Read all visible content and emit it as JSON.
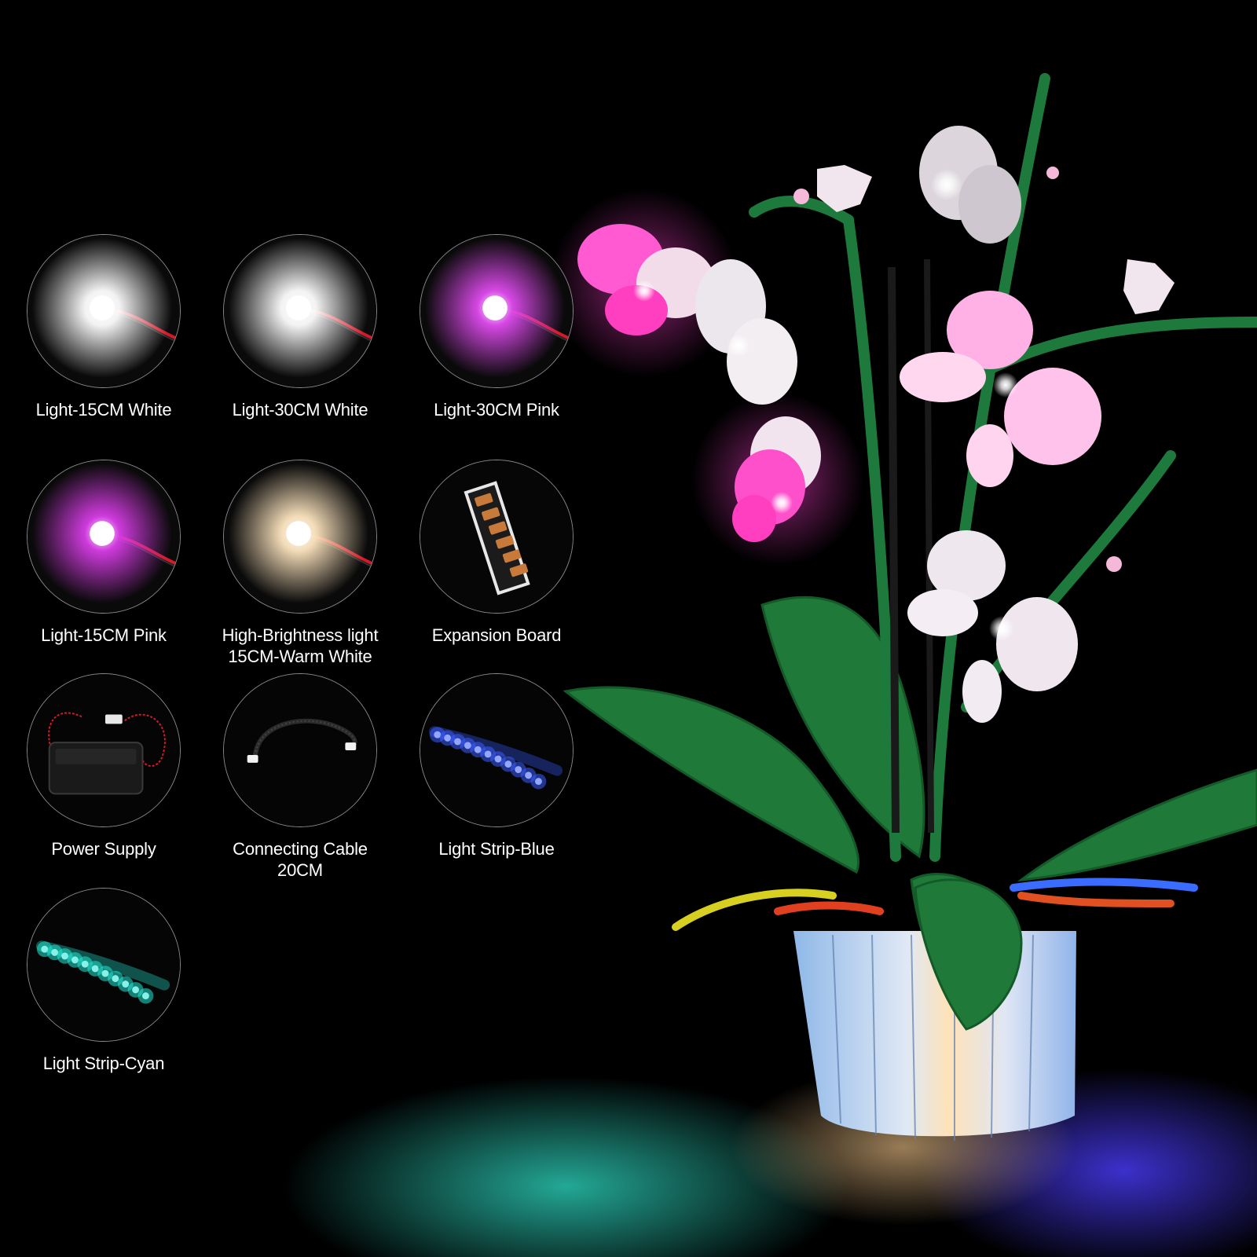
{
  "items": [
    {
      "lines": [
        "Light-15CM White"
      ],
      "icon": "white-led-15cm-icon",
      "glow": "#ffffff"
    },
    {
      "lines": [
        "Light-30CM White"
      ],
      "icon": "white-led-30cm-icon",
      "glow": "#ffffff"
    },
    {
      "lines": [
        "Light-30CM Pink"
      ],
      "icon": "pink-led-30cm-icon",
      "glow": "#e04bf0"
    },
    {
      "lines": [
        "Light-15CM Pink"
      ],
      "icon": "pink-led-15cm-icon",
      "glow": "#d93de8"
    },
    {
      "lines": [
        "High-Brightness light",
        "15CM-Warm White"
      ],
      "icon": "warm-white-led-icon",
      "glow": "#ffe6c0"
    },
    {
      "lines": [
        "Expansion Board"
      ],
      "icon": "expansion-board-icon"
    },
    {
      "lines": [
        "Power Supply"
      ],
      "icon": "battery-box-icon"
    },
    {
      "lines": [
        "Connecting Cable",
        "20CM"
      ],
      "icon": "cable-icon"
    },
    {
      "lines": [
        "Light Strip-Blue"
      ],
      "icon": "blue-light-strip-icon",
      "glow": "#3a5cff"
    },
    {
      "lines": [
        "Light Strip-Cyan"
      ],
      "icon": "cyan-light-strip-icon",
      "glow": "#22e6d2"
    }
  ]
}
